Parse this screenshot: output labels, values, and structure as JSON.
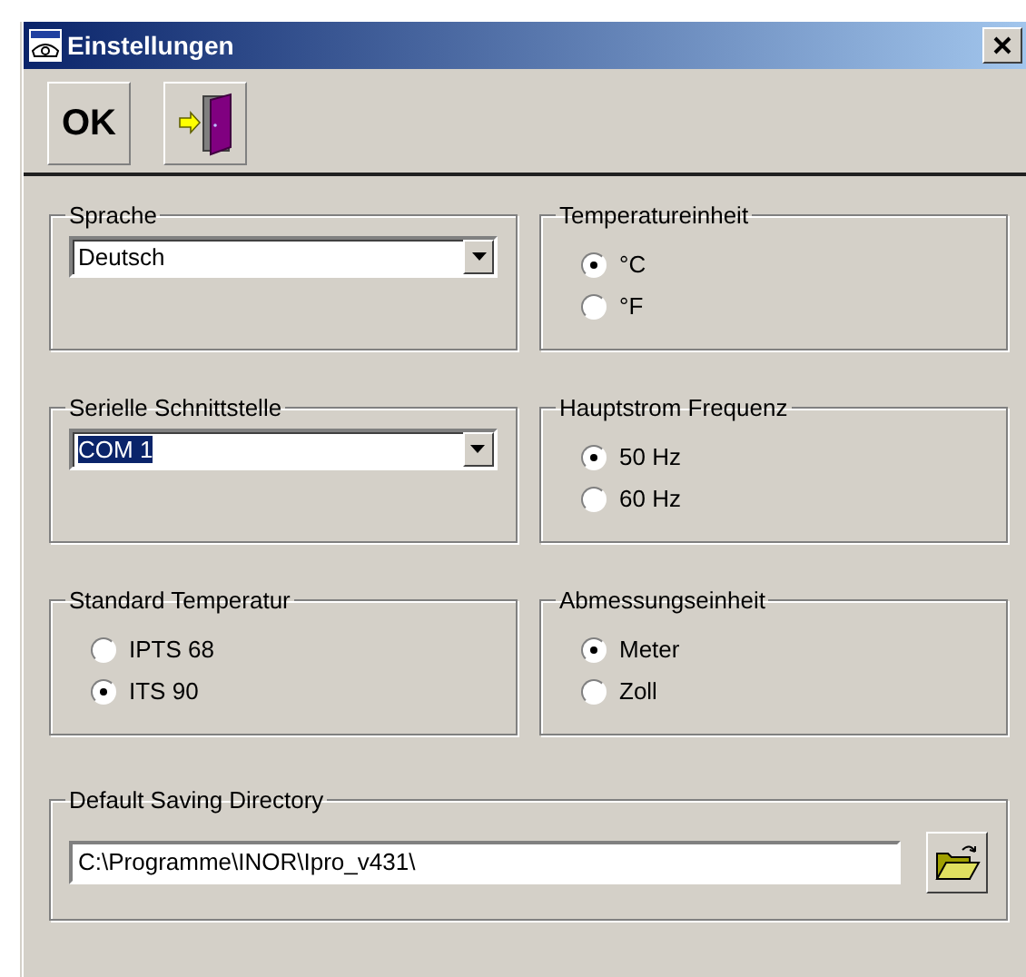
{
  "window": {
    "title": "Einstellungen"
  },
  "toolbar": {
    "ok_label": "OK"
  },
  "groups": [
    {
      "title": "Sprache",
      "kind": "dropdown",
      "value": "Deutsch",
      "highlighted": false
    },
    {
      "title": "Temperatureinheit",
      "kind": "radio",
      "options": [
        {
          "label": "°C",
          "selected": true
        },
        {
          "label": "°F",
          "selected": false
        }
      ]
    },
    {
      "title": "Serielle Schnittstelle",
      "kind": "dropdown",
      "value": "COM 1",
      "highlighted": true
    },
    {
      "title": "Hauptstrom Frequenz",
      "kind": "radio",
      "options": [
        {
          "label": "50 Hz",
          "selected": true
        },
        {
          "label": "60 Hz",
          "selected": false
        }
      ]
    },
    {
      "title": "Standard Temperatur",
      "kind": "radio",
      "options": [
        {
          "label": "IPTS 68",
          "selected": false
        },
        {
          "label": "ITS 90",
          "selected": true
        }
      ]
    },
    {
      "title": "Abmessungseinheit",
      "kind": "radio",
      "options": [
        {
          "label": "Meter",
          "selected": true
        },
        {
          "label": "Zoll",
          "selected": false
        }
      ]
    }
  ],
  "directory": {
    "title": "Default Saving Directory",
    "value": "C:\\Programme\\INOR\\Ipro_v431\\"
  }
}
